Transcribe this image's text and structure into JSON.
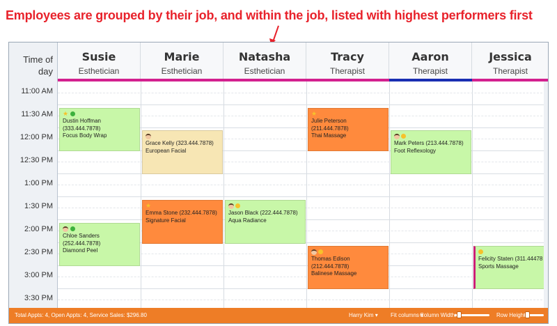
{
  "annotation": {
    "text": "Employees are grouped by their job, and within the job, listed with highest performers first",
    "color": "#e8222b"
  },
  "time_header": {
    "line1": "Time of",
    "line2": "day"
  },
  "staff": [
    {
      "name": "Susie",
      "job": "Esthetician",
      "job_color": "#d3208f"
    },
    {
      "name": "Marie",
      "job": "Esthetician",
      "job_color": "#d3208f"
    },
    {
      "name": "Natasha",
      "job": "Esthetician",
      "job_color": "#d3208f"
    },
    {
      "name": "Tracy",
      "job": "Therapist",
      "job_color": "#d3208f"
    },
    {
      "name": "Aaron",
      "job": "Therapist",
      "job_color": "#1a2fb2"
    },
    {
      "name": "Jessica",
      "job": "Therapist",
      "job_color": "#d3208f"
    }
  ],
  "times": [
    "11:00 AM",
    "11:30 AM",
    "12:00 PM",
    "12:30 PM",
    "1:00 PM",
    "1:30 PM",
    "2:00 PM",
    "2:30 PM",
    "3:00 PM",
    "3:30 PM"
  ],
  "appointments": [
    {
      "client": "Dustin Hoffman (333.444.7878)",
      "service": "Focus Body Wrap",
      "color": "green",
      "icons": [
        "star-icon",
        "green-dot-icon"
      ]
    },
    {
      "client": "Grace Kelly (323.444.7878)",
      "service": "European Facial",
      "color": "tan",
      "icons": [
        "face-icon"
      ]
    },
    {
      "client": "Chloe Sanders (252.444.7878)",
      "service": "Diamond Peel",
      "color": "green",
      "icons": [
        "face-icon",
        "green-dot-icon"
      ]
    },
    {
      "client": "Emma Stone (232.444.7878)",
      "service": "Signature Facial",
      "color": "orange",
      "icons": [
        "star-icon"
      ]
    },
    {
      "client": "Jason Black (222.444.7878)",
      "service": "Aqua Radiance",
      "color": "green",
      "icons": [
        "face-icon",
        "smile-icon"
      ]
    },
    {
      "client": "Julie Peterson (211.444.7878)",
      "service": "Thai Massage",
      "color": "orange",
      "icons": [
        "star-icon"
      ]
    },
    {
      "client": "Thomas Edison (212.444.7878)",
      "service": "Balinese Massage",
      "color": "orange",
      "icons": [
        "face-icon",
        "smile-icon"
      ]
    },
    {
      "client": "Mark Peters (213.444.7878)",
      "service": "Foot Reflexology",
      "color": "green",
      "icons": [
        "face-icon",
        "smile-icon"
      ]
    },
    {
      "client": "Felicity Staten (311.44478",
      "service": "Sports Massage",
      "color": "green",
      "icons": [
        "smile-icon"
      ]
    }
  ],
  "footer": {
    "summary": "Total Appts: 4, Open Appts: 4, Service Sales: $296.80",
    "user": "Harry Kim",
    "fit": "Fit columns",
    "column_width_label": "Column Width:",
    "row_height_label": "Row Height:",
    "color": "#ee7d26"
  }
}
